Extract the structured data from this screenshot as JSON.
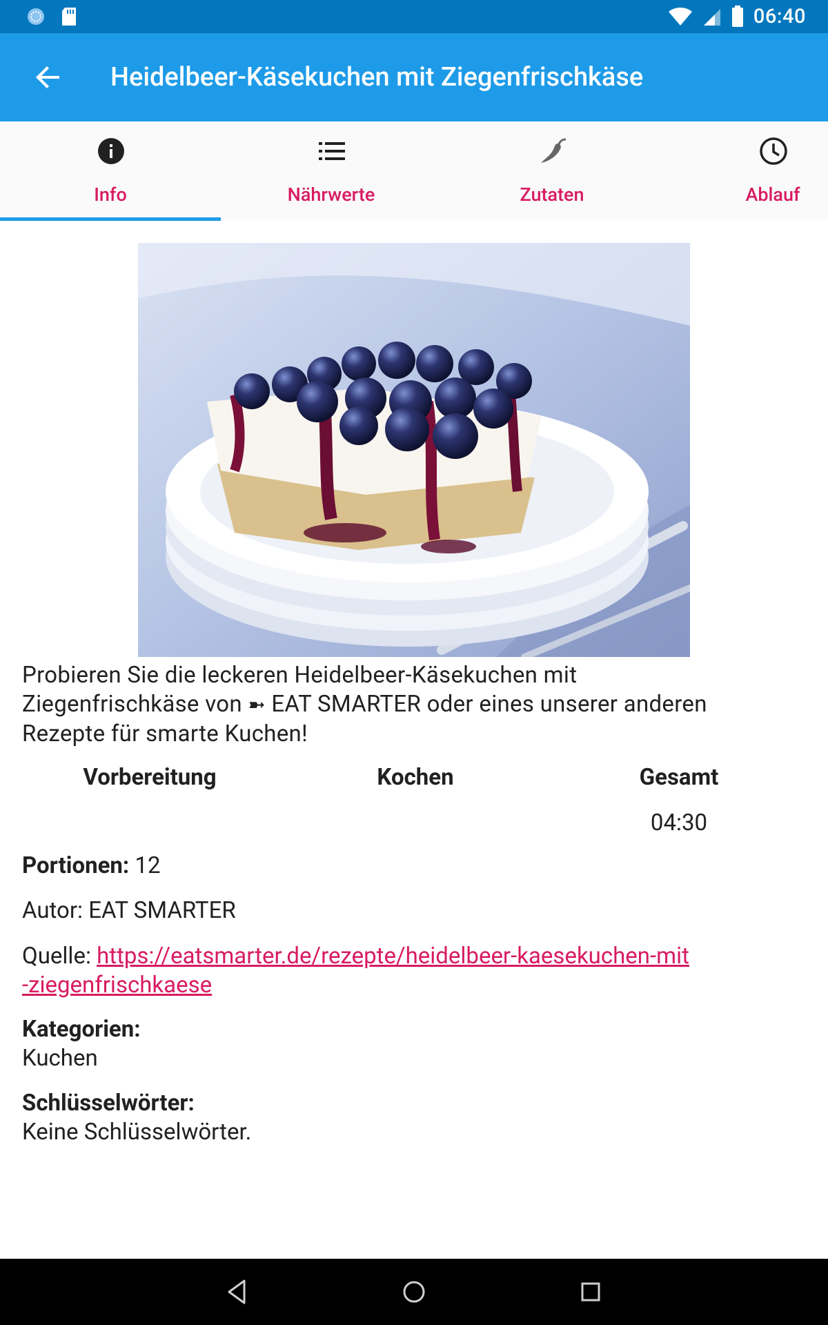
{
  "status_bar": {
    "time": "06:40",
    "icons": [
      "sync-icon",
      "sd-card-icon",
      "wifi-icon",
      "signal-icon",
      "battery-icon"
    ]
  },
  "app_bar": {
    "title": "Heidelbeer-Käsekuchen mit Ziegenfrischkäse",
    "back_icon": "arrow-back-icon"
  },
  "tabs": [
    {
      "label": "Info",
      "icon": "info-icon",
      "active": true
    },
    {
      "label": "Nährwerte",
      "icon": "list-icon",
      "active": false
    },
    {
      "label": "Zutaten",
      "icon": "chili-icon",
      "active": false
    },
    {
      "label": "Ablauf",
      "icon": "clock-icon",
      "active": false
    }
  ],
  "colors": {
    "status_bar": "#0277BD",
    "app_bar": "#1E9BE8",
    "accent": "#D81B60",
    "tab_indicator": "#1E9BE8"
  },
  "recipe": {
    "description_line1": "Probieren Sie die leckeren Heidelbeer-Käsekuchen mit",
    "description_line2_a": "Ziegenfrischkäse von",
    "description_arrow": "➼",
    "description_line2_b": "EAT SMARTER oder eines unserer anderen",
    "description_line3": "Rezepte für smarte Kuchen!",
    "times": {
      "prep_label": "Vorbereitung",
      "prep_value": "",
      "cook_label": "Kochen",
      "cook_value": "",
      "total_label": "Gesamt",
      "total_value": "04:30"
    },
    "portions_label": "Portionen:",
    "portions_value": "12",
    "author_label": "Autor:",
    "author_value": "EAT SMARTER",
    "source_label": "Quelle:",
    "source_url_line1": "https://eatsmarter.de/rezepte/heidelbeer-kaesekuchen-mit",
    "source_url_line2": "-ziegenfrischkaese",
    "categories_label": "Kategorien:",
    "categories_value": "Kuchen",
    "keywords_label": "Schlüsselwörter:",
    "keywords_value": "Keine Schlüsselwörter."
  },
  "nav_bar": {
    "buttons": [
      "back-triangle-icon",
      "home-circle-icon",
      "recents-square-icon"
    ]
  }
}
